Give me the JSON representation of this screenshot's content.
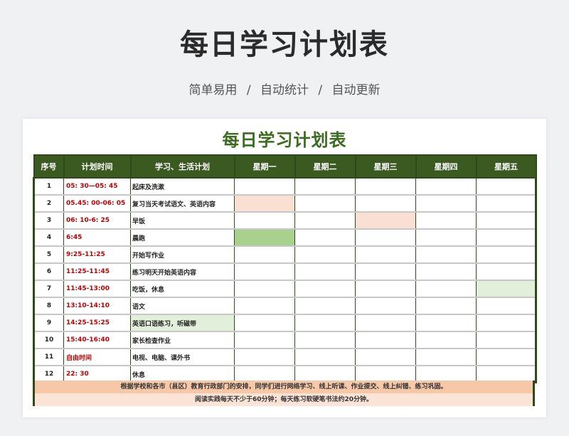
{
  "header": {
    "title": "每日学习计划表",
    "subtitle_parts": [
      "简单易用",
      "/",
      "自动统计",
      "/",
      "自动更新"
    ]
  },
  "sheet": {
    "title": "每日学习计划表",
    "columns": [
      "序号",
      "计划时间",
      "学习、生活计划",
      "星期一",
      "星期二",
      "星期三",
      "星期四",
      "星期五"
    ],
    "rows": [
      {
        "idx": "1",
        "time": "05: 30—05: 45",
        "plan": "起床及洗漱"
      },
      {
        "idx": "2",
        "time": "05.45: 00-06: 05",
        "plan": "复习当天考试语文、英语内容"
      },
      {
        "idx": "3",
        "time": "06: 10-6: 25",
        "plan": "早饭"
      },
      {
        "idx": "4",
        "time": "6:45",
        "plan": "晨跑"
      },
      {
        "idx": "5",
        "time": "9:25-11:25",
        "plan": "开始写作业"
      },
      {
        "idx": "6",
        "time": "11:25-11:45",
        "plan": "练习明天开始英语内容"
      },
      {
        "idx": "7",
        "time": "11:45-13:00",
        "plan": "吃饭，休息"
      },
      {
        "idx": "8",
        "time": "13:10-14:10",
        "plan": "语文"
      },
      {
        "idx": "9",
        "time": "14:25-15:25",
        "plan": "英语口语练习，听磁带"
      },
      {
        "idx": "10",
        "time": "15:40-16:40",
        "plan": "家长检查作业"
      },
      {
        "idx": "11",
        "time": "自由时间",
        "plan": "电视、电脑、课外书"
      },
      {
        "idx": "12",
        "time": "22: 30",
        "plan": "休息"
      }
    ],
    "highlight_colors": {
      "peach": "#f9e0d3",
      "green": "#a9d18e",
      "light_green": "#e2efda",
      "header": "#3b5a22"
    },
    "note_1": "根据学校和各市（县区）教育行政部门的安排，同学们进行网络学习、线上听课、作业提交、线上纠错、练习巩固。",
    "note_2": "阅读实践每天不少于60分钟；每天练习软硬笔书法约20分钟。"
  }
}
